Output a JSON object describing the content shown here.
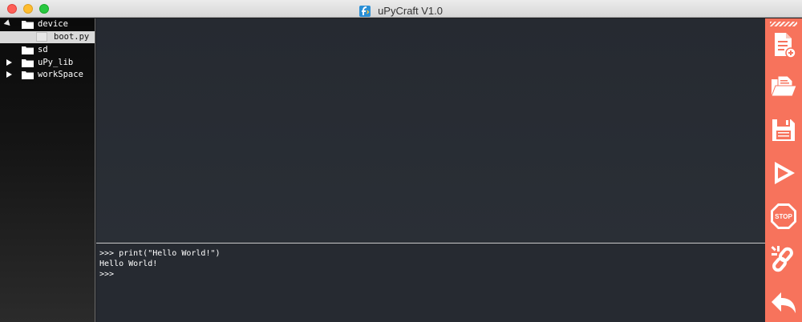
{
  "window": {
    "title": "uPyCraft V1.0"
  },
  "sidebar": {
    "items": [
      {
        "label": "device",
        "type": "folder",
        "expanded": true
      },
      {
        "label": "boot.py",
        "type": "file",
        "selected": true
      },
      {
        "label": "sd",
        "type": "folder"
      },
      {
        "label": "uPy_lib",
        "type": "folder",
        "expanded": false
      },
      {
        "label": "workSpace",
        "type": "folder",
        "expanded": false
      }
    ]
  },
  "terminal": {
    "lines": [
      ">>> print(\"Hello World!\")",
      "Hello World!",
      ">>>"
    ]
  },
  "toolbar": {
    "tools": [
      {
        "name": "new-file",
        "icon": "new-file-icon"
      },
      {
        "name": "open-file",
        "icon": "open-folder-icon"
      },
      {
        "name": "save",
        "icon": "save-icon"
      },
      {
        "name": "download-run",
        "icon": "play-icon"
      },
      {
        "name": "stop",
        "icon": "stop-icon",
        "text": "STOP"
      },
      {
        "name": "connect",
        "icon": "link-icon"
      },
      {
        "name": "undo",
        "icon": "undo-icon"
      }
    ],
    "background": "#f7735c"
  },
  "colors": {
    "editor_bg": "#262a31",
    "sidebar_bg": "#0a0a0a",
    "accent": "#f7735c"
  }
}
